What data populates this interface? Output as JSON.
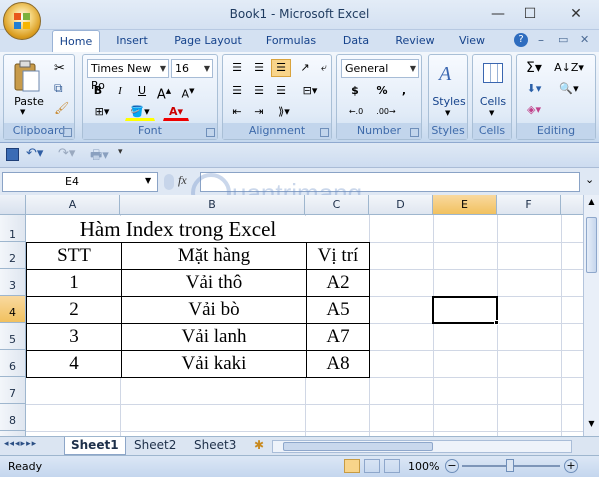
{
  "window": {
    "title": "Book1 - Microsoft Excel",
    "minimize": "—",
    "maximize": "☐",
    "close": "✕"
  },
  "tabs": [
    "Home",
    "Insert",
    "Page Layout",
    "Formulas",
    "Data",
    "Review",
    "View"
  ],
  "ribbon": {
    "clipboard": {
      "label": "Clipboard",
      "paste": "Paste"
    },
    "font": {
      "label": "Font",
      "name": "Times New Ro",
      "size": "16",
      "bold": "B",
      "italic": "I",
      "underline": "U"
    },
    "alignment": {
      "label": "Alignment"
    },
    "number": {
      "label": "Number",
      "format": "General",
      "currency": "$",
      "percent": "%",
      "comma": ","
    },
    "styles": {
      "label": "Styles"
    },
    "cells": {
      "label": "Cells"
    },
    "editing": {
      "label": "Editing",
      "sigma": "Σ"
    }
  },
  "formula_bar": {
    "name_box": "E4",
    "fx": "fx",
    "formula": ""
  },
  "watermark": "uantrimang",
  "columns": [
    "A",
    "B",
    "C",
    "D",
    "E",
    "F"
  ],
  "rows": [
    "1",
    "2",
    "3",
    "4",
    "5",
    "6",
    "7",
    "8"
  ],
  "sheet": {
    "title": "Hàm Index trong Excel",
    "headers": [
      "STT",
      "Mặt hàng",
      "Vị trí"
    ],
    "data": [
      [
        "1",
        "Vải thô",
        "A2"
      ],
      [
        "2",
        "Vải bò",
        "A5"
      ],
      [
        "3",
        "Vải lanh",
        "A7"
      ],
      [
        "4",
        "Vải kaki",
        "A8"
      ]
    ]
  },
  "sheet_tabs": [
    "Sheet1",
    "Sheet2",
    "Sheet3"
  ],
  "status": {
    "text": "Ready",
    "zoom": "100%"
  },
  "colors": {
    "selection": "#000000",
    "header_highlight": "#f5c96c",
    "grid": "#d0d7e5"
  }
}
